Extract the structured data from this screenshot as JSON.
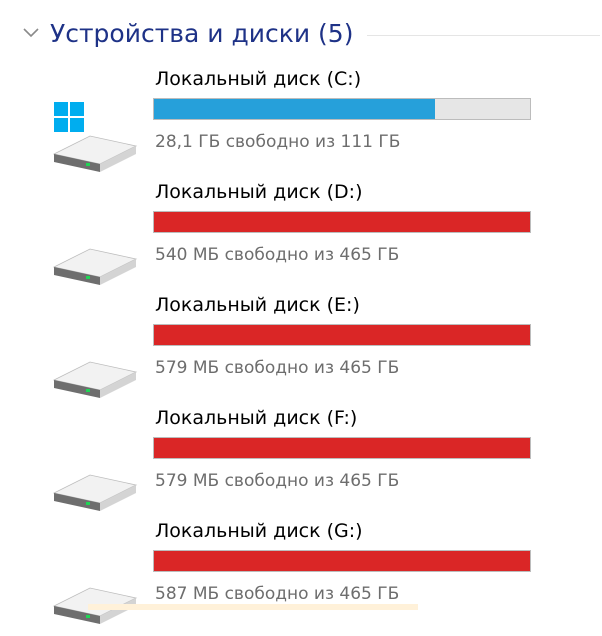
{
  "group": {
    "title": "Устройства и диски (5)"
  },
  "colors": {
    "used_normal": "#26a0da",
    "used_critical": "#da2626",
    "bar_bg": "#e6e6e6"
  },
  "drives": [
    {
      "name": "Локальный диск (C:)",
      "free_text": "28,1 ГБ свободно из 111 ГБ",
      "used_fraction": 0.747,
      "status": "normal",
      "icon": "windows-drive-icon"
    },
    {
      "name": "Локальный диск (D:)",
      "free_text": "540 МБ свободно из 465 ГБ",
      "used_fraction": 0.999,
      "status": "critical",
      "icon": "hard-drive-icon"
    },
    {
      "name": "Локальный диск (E:)",
      "free_text": "579 МБ свободно из 465 ГБ",
      "used_fraction": 0.999,
      "status": "critical",
      "icon": "hard-drive-icon"
    },
    {
      "name": "Локальный диск (F:)",
      "free_text": "579 МБ свободно из 465 ГБ",
      "used_fraction": 0.999,
      "status": "critical",
      "icon": "hard-drive-icon"
    },
    {
      "name": "Локальный диск (G:)",
      "free_text": "587 МБ свободно из 465 ГБ",
      "used_fraction": 0.999,
      "status": "critical",
      "icon": "hard-drive-icon"
    }
  ]
}
